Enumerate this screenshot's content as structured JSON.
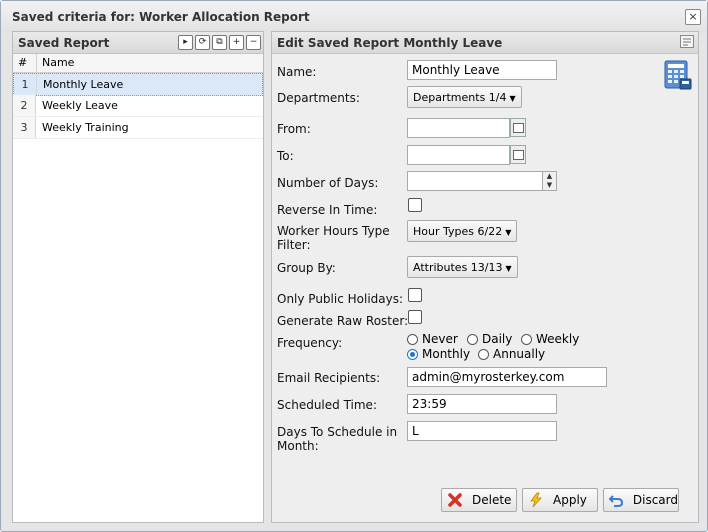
{
  "window": {
    "title": "Saved criteria for: Worker Allocation Report",
    "close_glyph": "×"
  },
  "left_panel": {
    "title": "Saved Report",
    "toolbar": [
      {
        "name": "run-button",
        "icon": "play-icon",
        "glyph": "▸"
      },
      {
        "name": "refresh-button",
        "icon": "refresh-icon",
        "glyph": "⟳"
      },
      {
        "name": "copy-button",
        "icon": "copy-icon",
        "glyph": "⧉"
      },
      {
        "name": "add-button",
        "icon": "plus-icon",
        "glyph": "+"
      },
      {
        "name": "remove-button",
        "icon": "minus-icon",
        "glyph": "−"
      }
    ],
    "columns": [
      "#",
      "Name"
    ],
    "rows": [
      {
        "num": "1",
        "name": "Monthly Leave",
        "selected": true
      },
      {
        "num": "2",
        "name": "Weekly Leave",
        "selected": false
      },
      {
        "num": "3",
        "name": "Weekly Training",
        "selected": false
      }
    ]
  },
  "form": {
    "title": "Edit Saved Report Monthly Leave",
    "name_label": "Name:",
    "name_value": "Monthly Leave",
    "departments_label": "Departments:",
    "departments_value": "Departments 1/4",
    "from_label": "From:",
    "from_value": "",
    "to_label": "To:",
    "to_value": "",
    "days_label": "Number of Days:",
    "days_value": "",
    "reverse_label": "Reverse In Time:",
    "worker_hours_label_1": "Worker Hours Type",
    "worker_hours_label_2": "Filter:",
    "worker_hours_value": "Hour Types 6/22",
    "group_by_label": "Group By:",
    "group_by_value": "Attributes 13/13",
    "public_holidays_label": "Only Public Holidays:",
    "raw_roster_label": "Generate Raw Roster:",
    "frequency_label": "Frequency:",
    "frequency_options": [
      "Never",
      "Daily",
      "Weekly",
      "Monthly",
      "Annually"
    ],
    "frequency_selected": "Monthly",
    "email_label": "Email Recipients:",
    "email_value": "admin@myrosterkey.com",
    "time_label": "Scheduled Time:",
    "time_value": "23:59",
    "days_month_label_1": "Days To Schedule in",
    "days_month_label_2": "Month:",
    "days_month_value": "L"
  },
  "buttons": {
    "delete": "Delete",
    "apply": "Apply",
    "discard": "Discard"
  },
  "colors": {
    "selected_row": "#dbe8f7",
    "radio_accent": "#1a73d8",
    "delete_icon": "#d93025",
    "apply_icon": "#e8b400",
    "discard_icon": "#3a7bd5"
  }
}
